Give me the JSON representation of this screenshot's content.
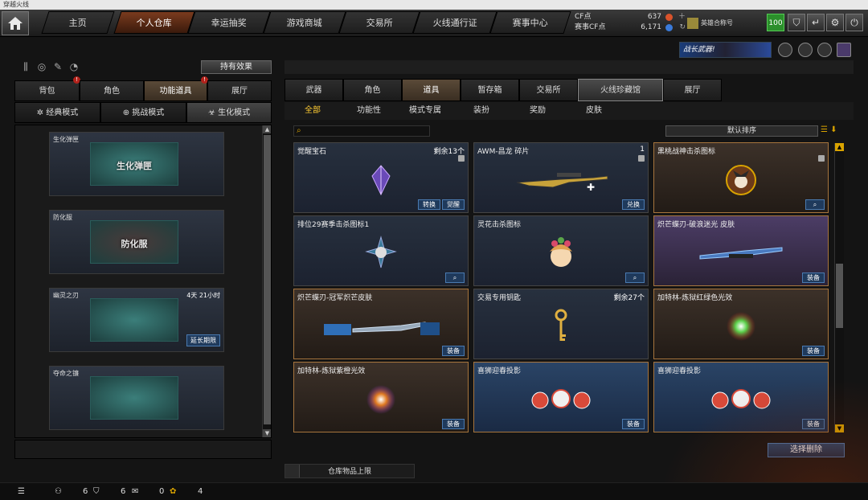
{
  "window": {
    "title": "穿越火线"
  },
  "nav": {
    "tabs": [
      {
        "label": "主页"
      },
      {
        "label": "个人仓库"
      },
      {
        "label": "幸运抽奖"
      },
      {
        "label": "游戏商城"
      },
      {
        "label": "交易所"
      },
      {
        "label": "火线通行证"
      },
      {
        "label": "赛事中心"
      }
    ],
    "active_tab": "个人仓库"
  },
  "currency": {
    "cf_label": "CF点",
    "cf_value": "637",
    "match_label": "赛事CF点",
    "match_value": "6,171"
  },
  "user": {
    "name": "英雄合称号",
    "level": "100"
  },
  "banner": {
    "text": "战长武器!"
  },
  "left_panel": {
    "effects_button": "持有效果",
    "subtabs": [
      {
        "label": "背包"
      },
      {
        "label": "角色"
      },
      {
        "label": "功能道具"
      },
      {
        "label": "展厅"
      }
    ],
    "modes": [
      {
        "label": "经典模式"
      },
      {
        "label": "挑战模式"
      },
      {
        "label": "生化模式"
      }
    ],
    "items": [
      {
        "name": "生化弹匣",
        "art_text": "生化弹匣",
        "time": ""
      },
      {
        "name": "防化服",
        "art_text": "防化服",
        "time": ""
      },
      {
        "name": "幽灵之刃",
        "art_text": "",
        "time": "4天 21小时",
        "extend": "延长期限"
      },
      {
        "name": "夺命之镰",
        "art_text": "",
        "time": ""
      }
    ]
  },
  "right_panel": {
    "categories": [
      {
        "label": "武器"
      },
      {
        "label": "角色"
      },
      {
        "label": "道具"
      },
      {
        "label": "暂存箱"
      },
      {
        "label": "交易所"
      },
      {
        "label": "火线珍藏馆"
      },
      {
        "label": "展厅"
      }
    ],
    "filters": [
      {
        "label": "全部"
      },
      {
        "label": "功能性"
      },
      {
        "label": "模式专属"
      },
      {
        "label": "装扮"
      },
      {
        "label": "奖励"
      },
      {
        "label": "皮肤"
      }
    ],
    "sort_label": "默认排序",
    "cards": [
      {
        "name": "觉醒宝石",
        "qty": "剩余13个",
        "btn1": "转换",
        "btn2": "觉醒"
      },
      {
        "name": "AWM-昌龙 碎片",
        "qty": "1",
        "btn1": "兑换"
      },
      {
        "name": "黑桃战神击杀图标",
        "qty": ""
      },
      {
        "name": "排位29赛季击杀图标1",
        "qty": ""
      },
      {
        "name": "灵花击杀图标",
        "qty": ""
      },
      {
        "name": "炽芒蝶刃-破浪迷光 皮肤",
        "qty": "",
        "btn1": "装备"
      },
      {
        "name": "炽芒蝶刃-冠军炽芒皮肤",
        "qty": "",
        "btn1": "装备"
      },
      {
        "name": "交易专用钥匙",
        "qty": "剩余27个"
      },
      {
        "name": "加特林-炼狱红绿色光效",
        "qty": "",
        "btn1": "装备"
      },
      {
        "name": "加特林-炼狱紫橙光效",
        "qty": "",
        "btn1": "装备"
      },
      {
        "name": "喜狮迎春投影",
        "qty": "",
        "btn1": "装备"
      },
      {
        "name": "喜狮迎春投影",
        "qty": "",
        "btn1": "装备"
      }
    ],
    "select_delete": "选择删除",
    "capacity": "仓库物品上限"
  },
  "status": {
    "a": "6",
    "b": "6",
    "c": "0",
    "d": "4"
  }
}
